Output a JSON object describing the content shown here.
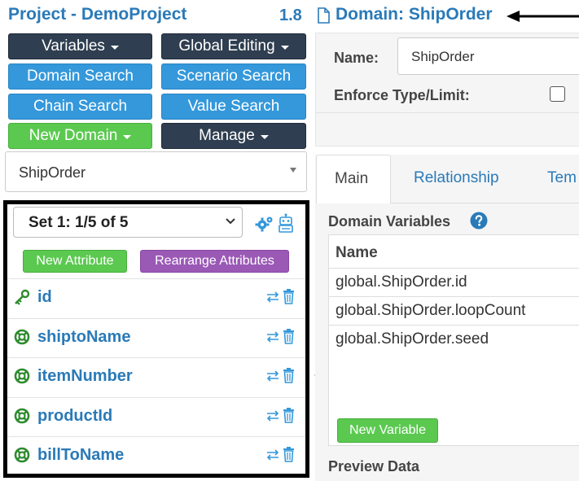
{
  "header": {
    "project_title": "Project - DemoProject",
    "version": "1.8",
    "domain_title": "Domain: ShipOrder"
  },
  "toolbar": {
    "variables": "Variables",
    "global_editing": "Global Editing",
    "domain_search": "Domain Search",
    "scenario_search": "Scenario Search",
    "chain_search": "Chain Search",
    "value_search": "Value Search",
    "new_domain": "New Domain",
    "manage": "Manage"
  },
  "domain_select": {
    "value": "ShipOrder"
  },
  "attributes": {
    "set_select": "Set 1: 1/5 of 5",
    "new_attribute": "New Attribute",
    "rearrange": "Rearrange Attributes",
    "items": [
      {
        "name": "id",
        "icon": "key-icon"
      },
      {
        "name": "shiptoName",
        "icon": "lifebuoy-icon"
      },
      {
        "name": "itemNumber",
        "icon": "lifebuoy-icon"
      },
      {
        "name": "productId",
        "icon": "lifebuoy-icon"
      },
      {
        "name": "billToName",
        "icon": "lifebuoy-icon"
      }
    ]
  },
  "domain_form": {
    "name_label": "Name:",
    "name_value": "ShipOrder",
    "enforce_label": "Enforce Type/Limit:",
    "enforce_checked": false
  },
  "tabs": [
    "Main",
    "Relationship",
    "Tem"
  ],
  "domain_variables": {
    "title": "Domain Variables",
    "column": "Name",
    "rows": [
      "global.ShipOrder.id",
      "global.ShipOrder.loopCount",
      "global.ShipOrder.seed"
    ],
    "new_button": "New Variable"
  },
  "preview_title": "Preview Data",
  "colors": {
    "link_blue": "#2a7ab8",
    "dark_button": "#2f3e50",
    "blue_button": "#3498db",
    "green_button": "#5bc950",
    "purple_button": "#9b59b6",
    "icon_green": "#2e8b2e"
  }
}
